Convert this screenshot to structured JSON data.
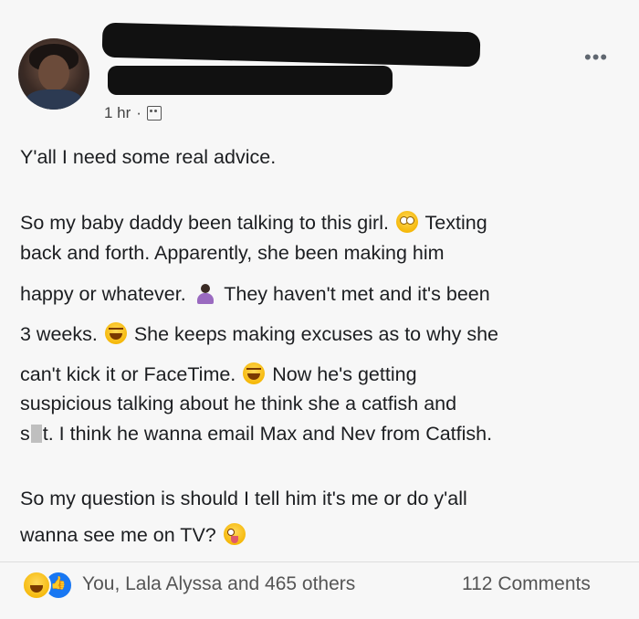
{
  "post": {
    "timestamp": "1 hr",
    "audience_icon": "friends-icon",
    "more_icon": "more-icon",
    "lines": [
      "Y'all I need some real advice.",
      "So my baby daddy been talking to this girl.",
      "Texting",
      "back and forth. Apparently, she been making him",
      "happy or whatever.",
      "They haven't met and it's been",
      "3 weeks.",
      "She keeps making excuses as to why she",
      "can't kick it or FaceTime.",
      "Now he's getting",
      "suspicious talking about he think she a catfish and",
      "s",
      "t. I think he wanna email Max and Nev from Catfish.",
      "So my question is should I tell him it's me or do y'all",
      "wanna see me on TV?"
    ]
  },
  "footer": {
    "reactions_text": "You, Lala Alyssa and 465 others",
    "comments_text": "112 Comments"
  }
}
